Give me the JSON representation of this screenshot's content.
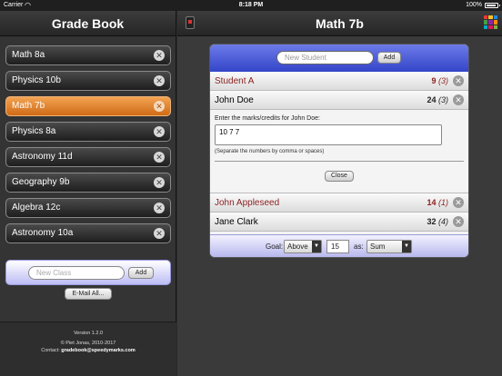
{
  "status": {
    "carrier": "Carrier",
    "time": "8:18 PM",
    "battery": "100%"
  },
  "left": {
    "title": "Grade Book",
    "classes": [
      {
        "name": "Math 8a",
        "selected": false
      },
      {
        "name": "Physics 10b",
        "selected": false
      },
      {
        "name": "Math 7b",
        "selected": true
      },
      {
        "name": "Physics 8a",
        "selected": false
      },
      {
        "name": "Astronomy 11d",
        "selected": false
      },
      {
        "name": "Geography 9b",
        "selected": false
      },
      {
        "name": "Algebra 12c",
        "selected": false
      },
      {
        "name": "Astronomy 10a",
        "selected": false
      }
    ],
    "new_class_placeholder": "New Class",
    "add_label": "Add",
    "email_label": "E-Mail All...",
    "footer": {
      "version": "Version 1.2.0",
      "copyright": "© Piet Jonas, 2010-2017",
      "contact_prefix": "Contact:",
      "contact_email": "gradebook@speedymarks.com"
    }
  },
  "right": {
    "title": "Math 7b",
    "new_student_placeholder": "New Student",
    "add_label": "Add",
    "students_top": [
      {
        "name": "Student A",
        "score": "9",
        "count": "(3)",
        "warn": true
      },
      {
        "name": "John Doe",
        "score": "24",
        "count": "(3)",
        "warn": false
      }
    ],
    "editor": {
      "prompt": "Enter the marks/credits for John Doe:",
      "value": "10 7 7",
      "hint": "(Separate the numbers by comma or spaces)",
      "close_label": "Close"
    },
    "students_bottom": [
      {
        "name": "John Appleseed",
        "score": "14",
        "count": "(1)",
        "warn": true
      },
      {
        "name": "Jane Clark",
        "score": "32",
        "count": "(4)",
        "warn": false
      }
    ],
    "goal": {
      "label": "Goal:",
      "comparison": "Above",
      "value": "15",
      "as_label": "as:",
      "aggregate": "Sum"
    }
  },
  "colors": {
    "accent_orange": "#e58a32",
    "header_blue": "#3345c9",
    "warn_red": "#8b1e1e",
    "grid_icon": [
      "#e53935",
      "#fbc02d",
      "#1e88e5",
      "#43a047",
      "#8e24aa",
      "#fb8c00",
      "#00acc1",
      "#d81b60",
      "#7cb342"
    ]
  }
}
